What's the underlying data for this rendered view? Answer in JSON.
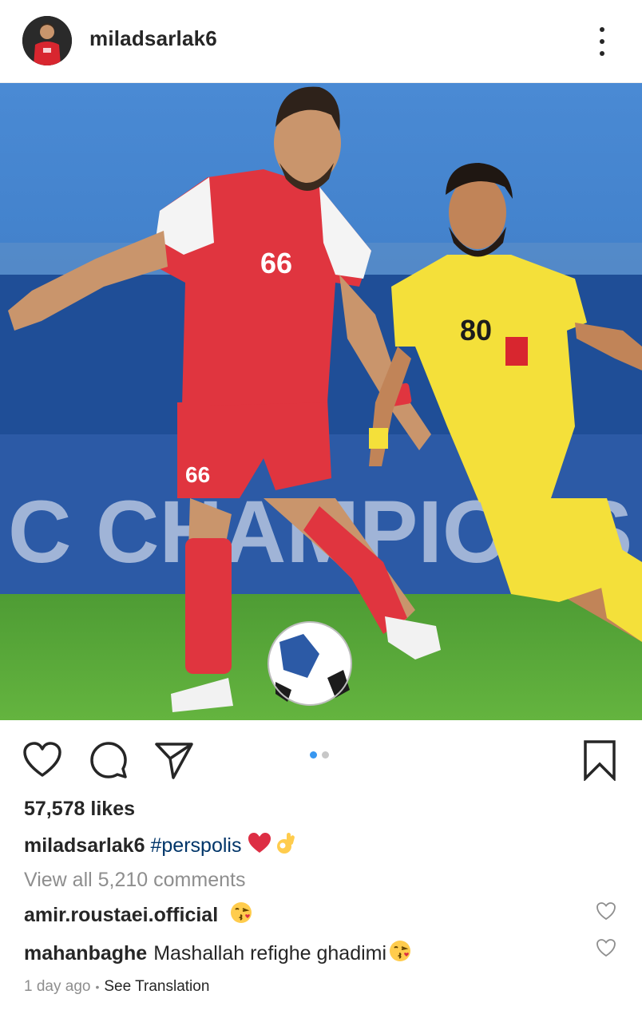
{
  "header": {
    "username": "miladsarlak6"
  },
  "photo": {
    "banner_text": "C CHAMPIONS",
    "player1_number": "66",
    "player2_number": "80",
    "colors": {
      "sky": "#3f7fc8",
      "stands": "#1f4f9a",
      "pitch": "#5aa93a",
      "red_kit": "#e0353f",
      "yellow_kit": "#f4e03a"
    }
  },
  "actions": {
    "like_icon": "heart-icon",
    "comment_icon": "comment-icon",
    "share_icon": "send-icon",
    "save_icon": "bookmark-icon",
    "carousel_count": 2,
    "carousel_active": 1
  },
  "post": {
    "likes": "57,578 likes",
    "caption_user": "miladsarlak6",
    "caption_tag": "#perspolis",
    "caption_emojis": [
      "red-heart",
      "ok-hand"
    ],
    "view_all": "View all 5,210 comments",
    "comments": [
      {
        "user": "amir.roustaei.official",
        "text": "",
        "emoji": "kissing-face"
      },
      {
        "user": "mahanbaghe",
        "text": "Mashallah refighe ghadimi",
        "emoji": "kissing-face"
      }
    ],
    "time_ago": "1 day ago",
    "separator": "•",
    "see_translation": "See Translation"
  },
  "colors": {
    "text": "#262626",
    "muted": "#8e8e8e",
    "hashtag": "#003569",
    "accent": "#3897f0"
  }
}
